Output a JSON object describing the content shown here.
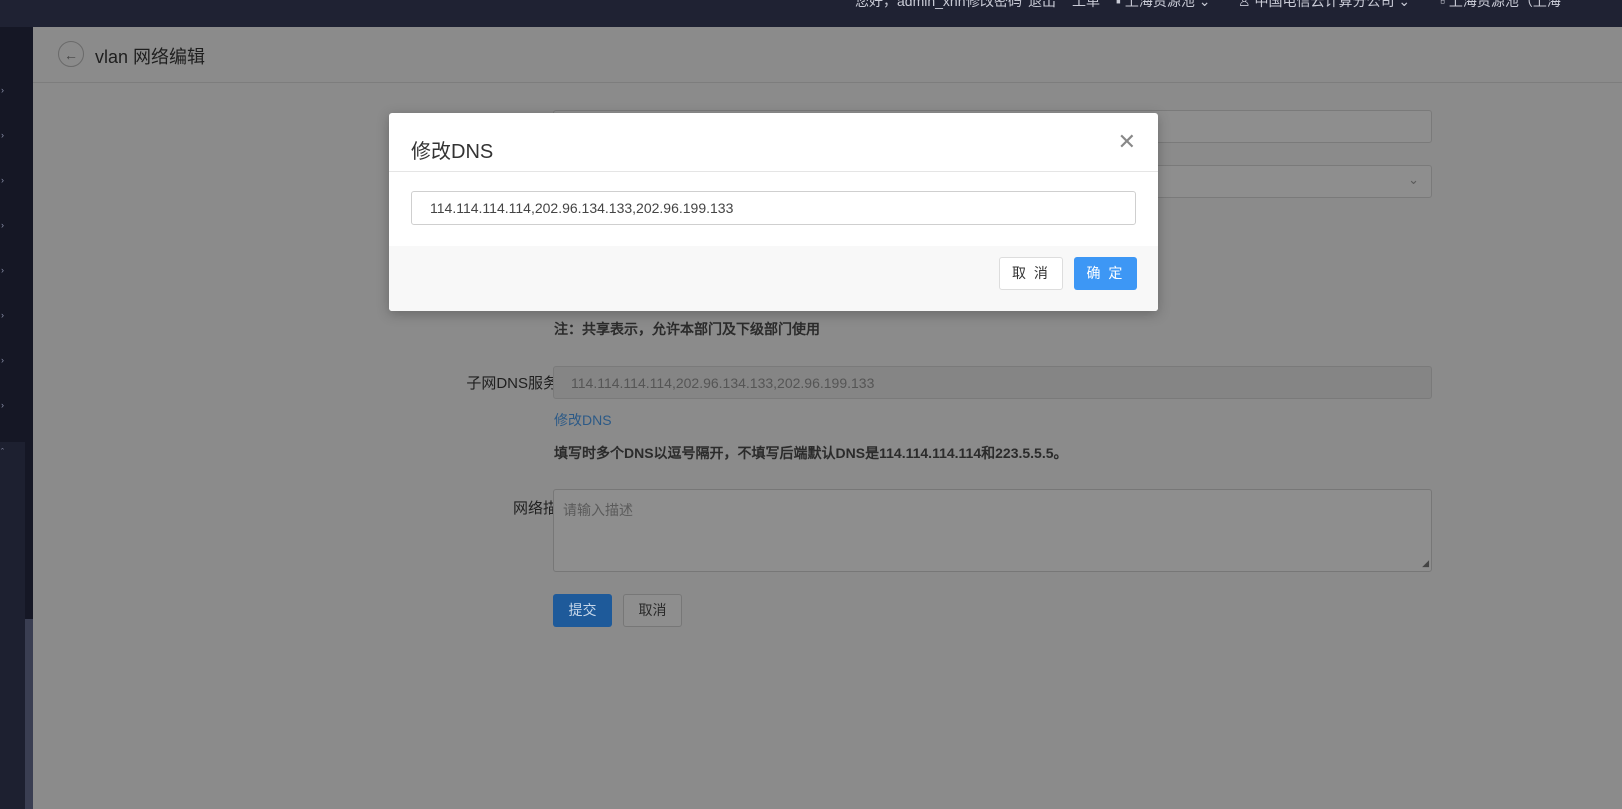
{
  "topbar": {
    "greeting": "您好，admin_xnn",
    "change_password": "修改密码",
    "logout": "退出",
    "workorder": "工单",
    "region": "上海资源池",
    "company": "中国电信云计算分公司",
    "project": "上海资源池（上海"
  },
  "page": {
    "title": "vlan 网络编辑"
  },
  "form": {
    "share_note": "注：共享表示，允许本部门及下级部门使用",
    "dns_label": "子网DNS服务器",
    "dns_value": "114.114.114.114,202.96.134.133,202.96.199.133",
    "modify_dns_link": "修改DNS",
    "dns_note": "填写时多个DNS以逗号隔开，不填写后端默认DNS是114.114.114.114和223.5.5.5。",
    "desc_label": "网络描述",
    "desc_placeholder": "请输入描述",
    "submit_label": "提交",
    "cancel_label": "取消"
  },
  "modal": {
    "title": "修改DNS",
    "input_value": "114.114.114.114,202.96.134.133,202.96.199.133",
    "cancel_label": "取 消",
    "ok_label": "确 定"
  },
  "colors": {
    "primary": "#3d97f5",
    "topbar": "#1f2233",
    "overlay_bg": "#8b8b8b"
  },
  "icons": {
    "back": "arrow-left-icon",
    "close": "close-icon",
    "select": "chevron-down-icon"
  }
}
